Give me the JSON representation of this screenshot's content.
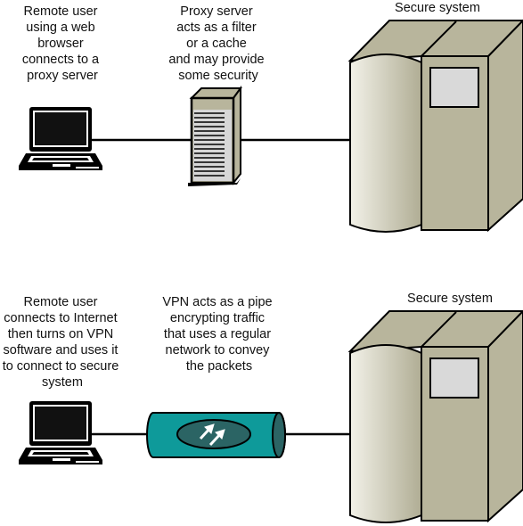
{
  "top": {
    "user_caption": [
      "Remote user",
      "using a web",
      "browser",
      "connects to a",
      "proxy server"
    ],
    "proxy_caption": [
      "Proxy server",
      "acts as a filter",
      "or a cache",
      "and may provide",
      "some security"
    ],
    "system_label": "Secure system"
  },
  "bottom": {
    "user_caption": [
      "Remote user",
      "connects to Internet",
      "then turns on VPN",
      "software and uses it",
      "to connect to secure",
      "system"
    ],
    "vpn_caption": [
      "VPN acts as a pipe",
      "encrypting traffic",
      "that uses a regular",
      "network to convey",
      "the packets"
    ],
    "system_label": "Secure system"
  },
  "colors": {
    "server_body": "#b8b59c",
    "server_window": "#d9d9d9",
    "pipe": "#0e9a9a",
    "pipe_dark": "#2b6464"
  }
}
